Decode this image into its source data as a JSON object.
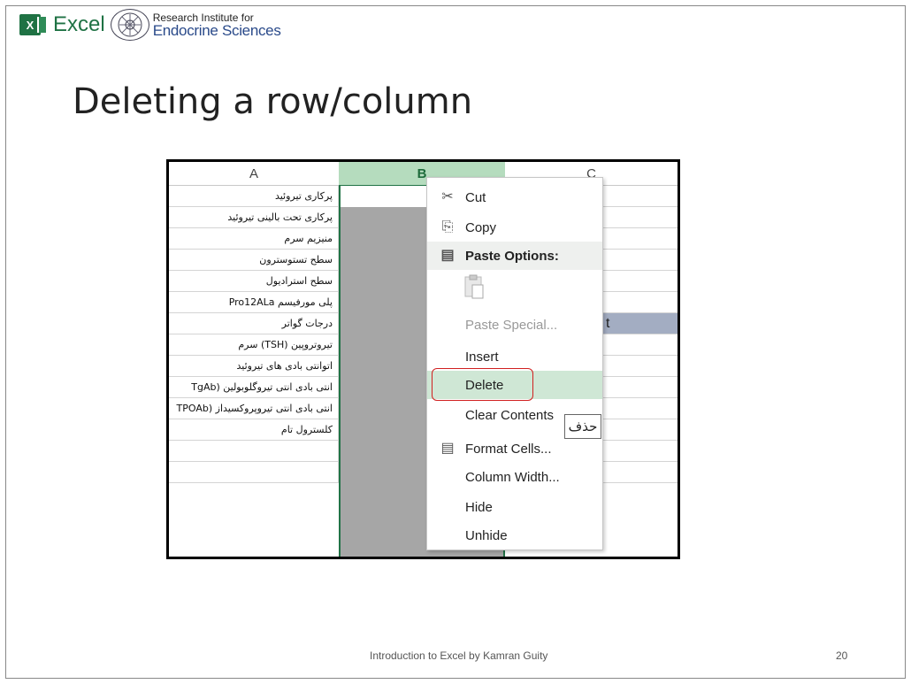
{
  "header": {
    "app_name": "Excel",
    "app_logo_letter": "X",
    "institute_line1": "Research Institute for",
    "institute_line2": "Endocrine Sciences"
  },
  "title": "Deleting a row/column",
  "sheet": {
    "columns": [
      "A",
      "B",
      "C"
    ],
    "selected_column": "B",
    "rows_a": [
      "پرکاری تیروئید",
      "پرکاری تحت بالینی تیروئید",
      "منیزیم سرم",
      "سطح تستوسترون",
      "سطح استرادیول",
      "پلی مورفیسم Pro12ALa",
      "درجات گواتر",
      "تیروتروپین (TSH) سرم",
      "اتوانتی بادی های تیروئید",
      "انتی بادی انتی تیروگلوبولین (TgAb",
      "انتی بادی انتی تیروپروکسیداز (TPOAb",
      "کلسترول تام",
      "",
      ""
    ],
    "c_fragment": "t"
  },
  "context_menu": {
    "items": [
      {
        "label": "Cut",
        "icon": "scissors-icon",
        "glyph": "✂"
      },
      {
        "label": "Copy",
        "icon": "copy-icon",
        "glyph": "⎘"
      },
      {
        "label": "Paste Options:",
        "icon": "paste-icon",
        "glyph": "📋"
      },
      {
        "label": "Paste Special...",
        "icon": "",
        "glyph": ""
      },
      {
        "label": "Insert",
        "icon": "",
        "glyph": ""
      },
      {
        "label": "Delete",
        "icon": "",
        "glyph": ""
      },
      {
        "label": "Clear Contents",
        "icon": "",
        "glyph": ""
      },
      {
        "label": "Format Cells...",
        "icon": "format-cells-icon",
        "glyph": "▤"
      },
      {
        "label": "Column Width...",
        "icon": "",
        "glyph": ""
      },
      {
        "label": "Hide",
        "icon": "",
        "glyph": ""
      },
      {
        "label": "Unhide",
        "icon": "",
        "glyph": ""
      }
    ]
  },
  "tooltip": "حذف",
  "footer": {
    "text": "Introduction to Excel by Kamran Guity",
    "page": "20"
  },
  "colors": {
    "excel_green": "#217346",
    "selected_column": "#a6a6a6",
    "highlight": "#cfe7d5",
    "red_outline": "#d02020"
  }
}
